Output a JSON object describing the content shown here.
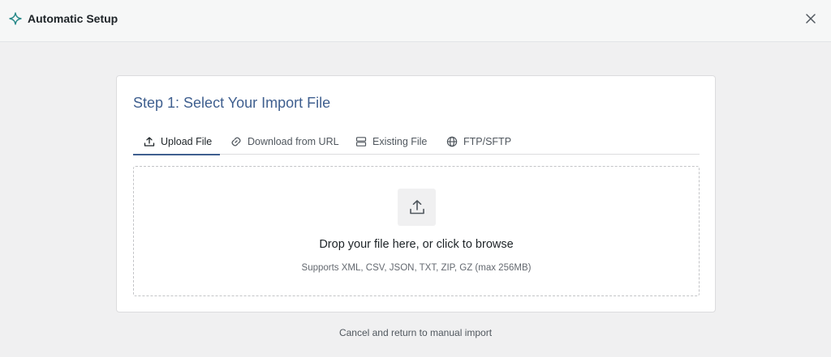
{
  "header": {
    "title": "Automatic Setup",
    "icon": "sparkle-icon",
    "accent_color": "#2a8a8a",
    "close_icon": "close-icon"
  },
  "card": {
    "step_title": "Step 1: Select Your Import File",
    "tabs": [
      {
        "label": "Upload File",
        "icon": "upload-icon",
        "active": true
      },
      {
        "label": "Download from URL",
        "icon": "link-icon",
        "active": false
      },
      {
        "label": "Existing File",
        "icon": "server-icon",
        "active": false
      },
      {
        "label": "FTP/SFTP",
        "icon": "globe-icon",
        "active": false
      }
    ],
    "dropzone": {
      "icon": "upload-icon",
      "title": "Drop your file here, or click to browse",
      "subtitle": "Supports XML, CSV, JSON, TXT, ZIP, GZ (max 256MB)"
    }
  },
  "footer": {
    "cancel_label": "Cancel and return to manual import"
  },
  "colors": {
    "title_blue": "#3f5f8f",
    "background": "#f0f0f1",
    "card": "#ffffff"
  }
}
